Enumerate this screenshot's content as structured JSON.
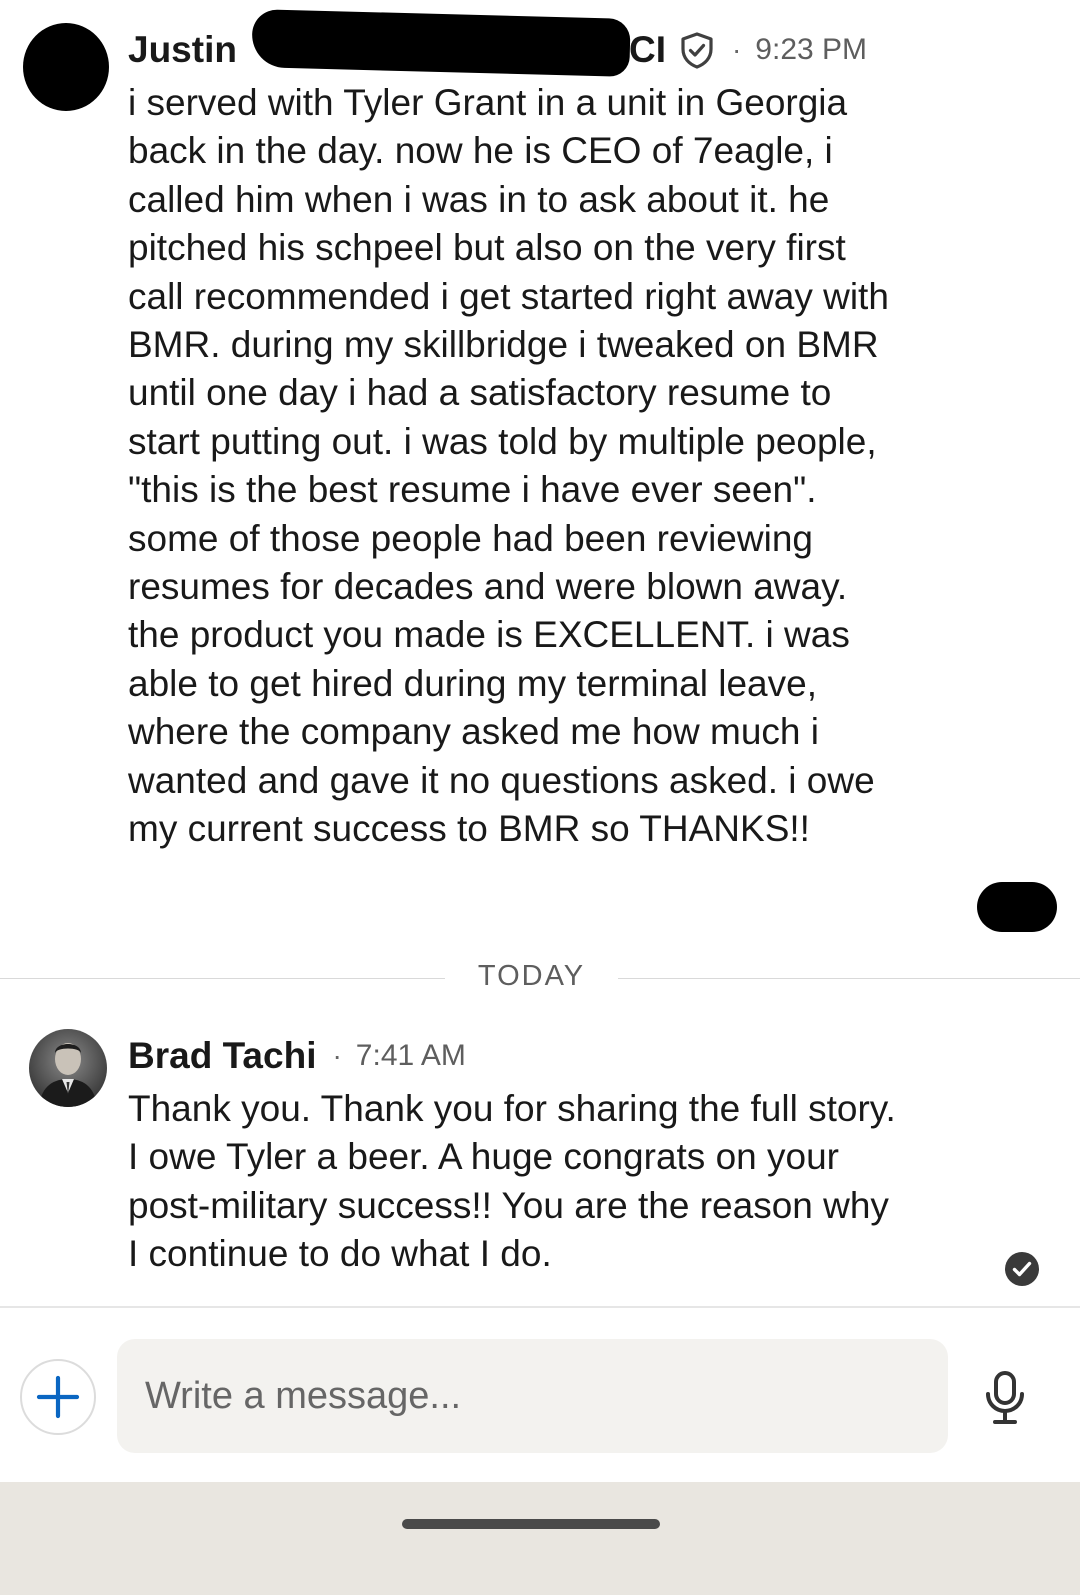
{
  "message1": {
    "sender_first": "Justin",
    "sender_suffix": "CI",
    "time": "9:23 PM",
    "body": "i served with Tyler Grant in a unit in Georgia\nback in the day. now he is CEO of 7eagle, i\ncalled him when i was in to ask about it. he\npitched his schpeel but also on the very first\ncall recommended i get started right away with\nBMR. during my skillbridge i tweaked on BMR\nuntil one day i had a satisfactory resume to\nstart putting out. i was told by multiple people,\n\"this is the best resume i have ever seen\".\nsome of those people had been reviewing\nresumes for decades and were blown away.\nthe product you made is EXCELLENT. i was\nable to get hired during my terminal leave,\nwhere the company asked me how much i\nwanted and gave it no questions asked. i owe\nmy current success to BMR so THANKS!!"
  },
  "divider": {
    "label": "TODAY"
  },
  "message2": {
    "sender": "Brad Tachi",
    "time": "7:41 AM",
    "body": "Thank you. Thank you for sharing the full story.\nI owe Tyler a beer. A huge congrats on your\npost-military success!! You are the reason why\nI continue to do what I do."
  },
  "composer": {
    "placeholder": "Write a message..."
  },
  "separator": "·",
  "colors": {
    "accent": "#0a66c2",
    "text": "#191919",
    "muted": "#5e5e5e",
    "input_bg": "#f3f2ef",
    "nav_bg": "#e9e6e0"
  },
  "icons": {
    "attach": "plus-icon",
    "mic": "microphone-icon",
    "verified": "shield-check-icon",
    "read": "check-circle-icon"
  }
}
